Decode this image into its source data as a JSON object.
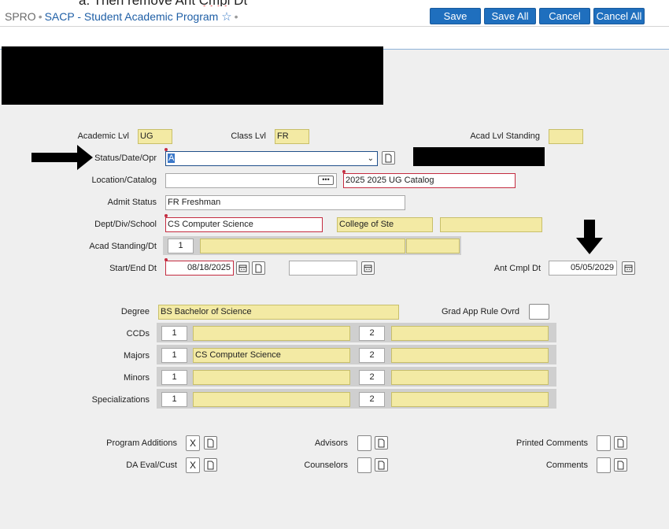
{
  "cut_off_text": {
    "prefix": "a. Then remove Ant ",
    "err": "Cmpl",
    "suffix": " Dt"
  },
  "breadcrumb": {
    "app": "SPRO",
    "sep": "•",
    "title": "SACP - Student Academic Program"
  },
  "toolbar": {
    "save": "Save",
    "save_all": "Save All",
    "cancel": "Cancel",
    "cancel_all": "Cancel All"
  },
  "form": {
    "academic_lvl": {
      "label": "Academic Lvl",
      "value": "UG"
    },
    "class_lvl": {
      "label": "Class Lvl",
      "value": "FR"
    },
    "acad_lvl_standing": {
      "label": "Acad Lvl Standing",
      "value": ""
    },
    "status_date_opr": {
      "label": "Status/Date/Opr",
      "value": "A"
    },
    "location_catalog": {
      "label": "Location/Catalog",
      "location": "",
      "catalog": "2025 2025 UG Catalog"
    },
    "admit_status": {
      "label": "Admit Status",
      "value": "FR Freshman"
    },
    "dept_div_school": {
      "label": "Dept/Div/School",
      "dept": "CS Computer Science",
      "div": "College of Ste",
      "school": ""
    },
    "acad_standing_dt": {
      "label": "Acad Standing/Dt",
      "num": "1"
    },
    "start_end_dt": {
      "label": "Start/End Dt",
      "start": "08/18/2025",
      "end": ""
    },
    "ant_cmpl_dt": {
      "label": "Ant Cmpl Dt",
      "value": "05/05/2029"
    },
    "degree": {
      "label": "Degree",
      "value": "BS Bachelor of Science"
    },
    "grad_app_rule_ovrd": {
      "label": "Grad App Rule Ovrd",
      "value": ""
    },
    "ccds": {
      "label": "CCDs",
      "n1": "1",
      "v1": "",
      "n2": "2",
      "v2": ""
    },
    "majors": {
      "label": "Majors",
      "n1": "1",
      "v1": "CS Computer Science",
      "n2": "2",
      "v2": ""
    },
    "minors": {
      "label": "Minors",
      "n1": "1",
      "v1": "",
      "n2": "2",
      "v2": ""
    },
    "specializations": {
      "label": "Specializations",
      "n1": "1",
      "v1": "",
      "n2": "2",
      "v2": ""
    },
    "program_additions": {
      "label": "Program Additions",
      "value": "X"
    },
    "da_eval_cust": {
      "label": "DA Eval/Cust",
      "value": "X"
    },
    "advisors": {
      "label": "Advisors",
      "value": ""
    },
    "counselors": {
      "label": "Counselors",
      "value": ""
    },
    "printed_comments": {
      "label": "Printed Comments",
      "value": ""
    },
    "comments": {
      "label": "Comments",
      "value": ""
    }
  },
  "colors": {
    "accent": "#1f6fbe",
    "required": "#c42c40",
    "readonly": "#f3eaa4"
  }
}
